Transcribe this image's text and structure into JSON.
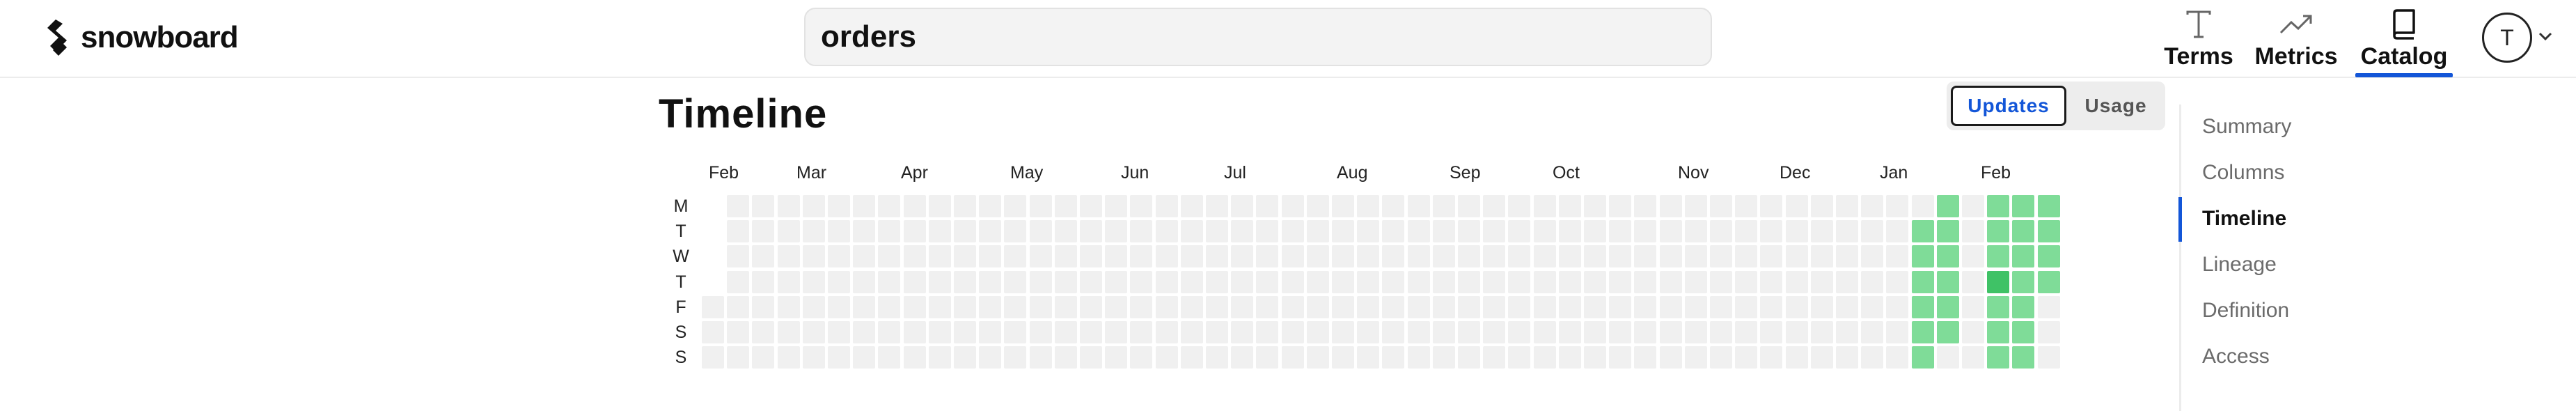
{
  "app": {
    "name": "snowboard",
    "brand_color": "#1356d8"
  },
  "search": {
    "value": "orders",
    "icon": "none"
  },
  "nav": {
    "items": [
      {
        "label": "Terms",
        "icon": "text-t-icon"
      },
      {
        "label": "Metrics",
        "icon": "trend-up-icon"
      },
      {
        "label": "Catalog",
        "icon": "book-icon",
        "active": true
      }
    ]
  },
  "user": {
    "initial": "T"
  },
  "timeline": {
    "title": "Timeline",
    "toggle": {
      "options": [
        "Updates",
        "Usage"
      ],
      "selected": "Updates"
    }
  },
  "heatmap": {
    "months": [
      "Feb",
      "Mar",
      "Apr",
      "May",
      "Jun",
      "Jul",
      "Aug",
      "Sep",
      "Oct",
      "Nov",
      "Dec",
      "Jan",
      "Feb"
    ],
    "days": [
      "M",
      "T",
      "W",
      "T",
      "F",
      "S",
      "S"
    ],
    "colors": {
      "empty": "#f0f0f0",
      "light": "#7fdc98",
      "medium": "#5fd17f",
      "dark": "#3fc266"
    },
    "weeks": 54,
    "first_week_start_day": 4,
    "active": [
      {
        "week": 48,
        "days": [
          1,
          2,
          3,
          4,
          5,
          6
        ],
        "level": "light"
      },
      {
        "week": 49,
        "days": [
          0,
          1,
          2,
          3,
          4,
          5
        ],
        "level": "light"
      },
      {
        "week": 51,
        "days": [
          0,
          1,
          2,
          4,
          5,
          6
        ],
        "level": "light"
      },
      {
        "week": 51,
        "days": [
          3
        ],
        "level": "dark"
      },
      {
        "week": 52,
        "days": [
          0,
          1,
          2,
          3,
          4,
          5,
          6
        ],
        "level": "light"
      },
      {
        "week": 53,
        "days": [
          0,
          1,
          2,
          3
        ],
        "level": "light"
      }
    ],
    "last_week_end_day": 6
  },
  "sidenav": {
    "items": [
      "Summary",
      "Columns",
      "Timeline",
      "Lineage",
      "Definition",
      "Access"
    ],
    "active": "Timeline"
  }
}
